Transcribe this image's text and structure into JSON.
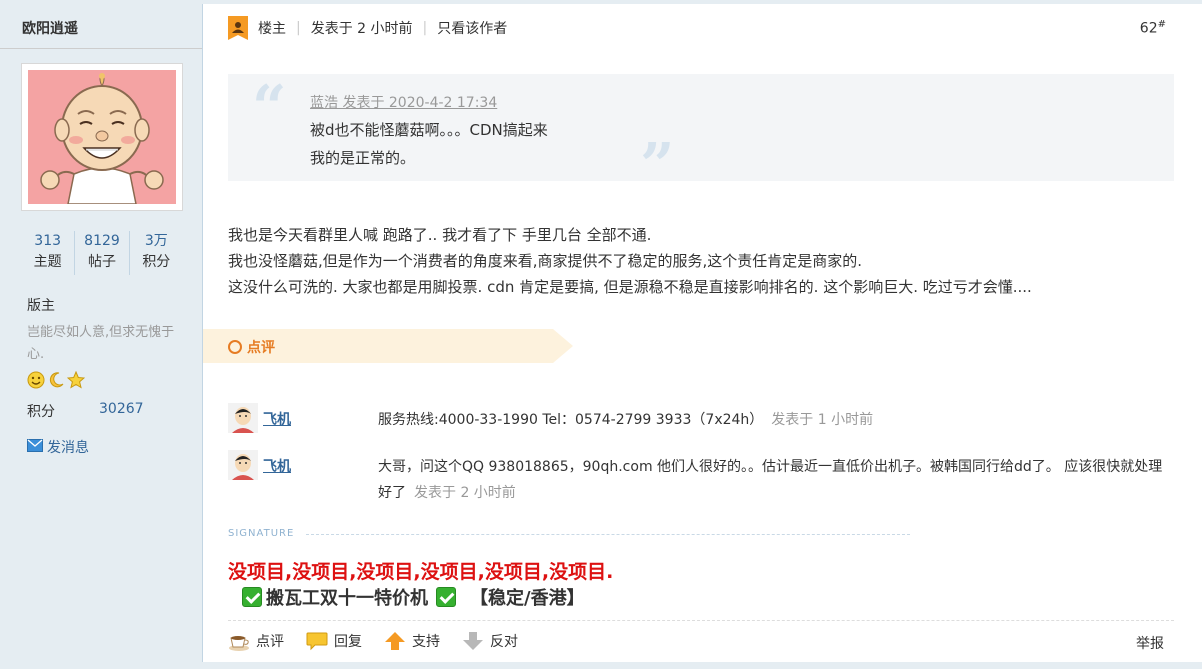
{
  "sidebar": {
    "author_name": "欧阳逍遥",
    "stats": [
      {
        "value": "313",
        "label": "主题"
      },
      {
        "value": "8129",
        "label": "帖子"
      },
      {
        "value": "3万",
        "label": "积分"
      }
    ],
    "role": "版主",
    "motto": "岂能尽如人意,但求无愧于心.",
    "points_label": "积分",
    "points_value": "30267",
    "send_message": "发消息",
    "badge_icons": [
      "smiley-icon",
      "moon-icon",
      "star-icon"
    ]
  },
  "post": {
    "op_label": "楼主",
    "posted_time": "发表于 2 小时前",
    "only_author": "只看该作者",
    "floor": "62",
    "floor_mark": "#",
    "quote": {
      "meta": "蓝浩 发表于 2020-4-2 17:34",
      "line1": "被d也不能怪蘑菇啊。。。CDN搞起来",
      "line2": "我的是正常的。"
    },
    "body": [
      "我也是今天看群里人喊 跑路了.. 我才看了下  手里几台 全部不通.",
      "我也没怪蘑菇,但是作为一个消费者的角度来看,商家提供不了稳定的服务,这个责任肯定是商家的.",
      "这没什么可洗的. 大家也都是用脚投票.    cdn 肯定是要搞, 但是源稳不稳是直接影响排名的. 这个影响巨大. 吃过亏才会懂...."
    ]
  },
  "comments": {
    "tab_label": "点评",
    "items": [
      {
        "user": "飞机",
        "text": "服务热线:4000-33-1990 Tel：0574-2799 3933（7x24h）",
        "time": "发表于 1 小时前"
      },
      {
        "user": "飞机",
        "text": "大哥，问这个QQ 938018865，90qh.com 他们人很好的。。估计最近一直低价出机子。被韩国同行给dd了。 应该很快就处理好了",
        "time": "发表于 2 小时前"
      }
    ]
  },
  "signature": {
    "label": "SIGNATURE",
    "red_text": "没项目,没项目,没项目,没项目,没项目,没项目.",
    "promo_text": "搬瓦工双十一特价机",
    "promo_tag": "【稳定/香港】"
  },
  "actions": {
    "comment": "点评",
    "reply": "回复",
    "support": "支持",
    "oppose": "反对",
    "report": "举报"
  },
  "colors": {
    "sidebar_bg": "#e5edf2",
    "link": "#336699",
    "accent_orange": "#e67c23",
    "signature_red": "#dd1111"
  }
}
